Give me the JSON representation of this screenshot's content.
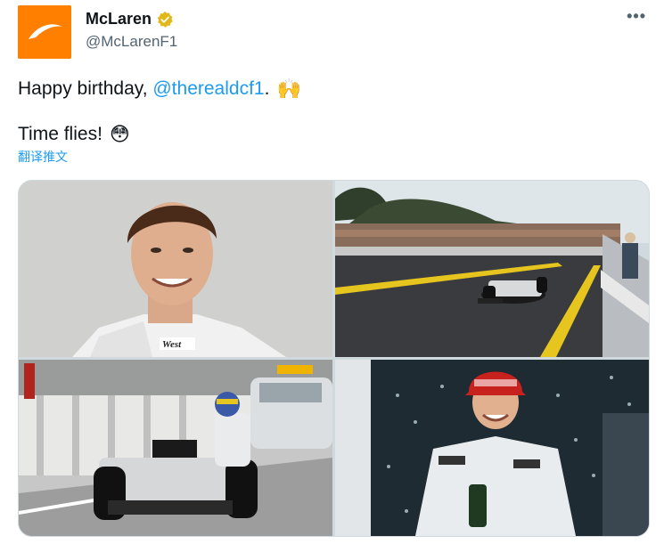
{
  "author": {
    "name": "McLaren",
    "handle": "@McLarenF1",
    "verified": true,
    "brand_color": "#ff8000"
  },
  "tweet": {
    "line1_prefix": "Happy birthday, ",
    "mention": "@therealdcf1",
    "line1_suffix": ".",
    "line1_emoji": "🙌",
    "line2_text": "Time flies!",
    "line2_emoji": "😳",
    "translate_label": "翻译推文"
  },
  "more_icon": "more-horizontal-icon",
  "more_glyph": "•••",
  "media": {
    "photo1": {
      "icon": "portrait-photo",
      "text": "West"
    },
    "photo2": {
      "icon": "race-car-track-photo"
    },
    "photo3": {
      "icon": "race-car-pitlane-photo"
    },
    "photo4": {
      "icon": "podium-celebration-photo"
    }
  },
  "colors": {
    "link": "#1d9bf0",
    "secondary_text": "#536471",
    "border": "#cfd9de"
  }
}
